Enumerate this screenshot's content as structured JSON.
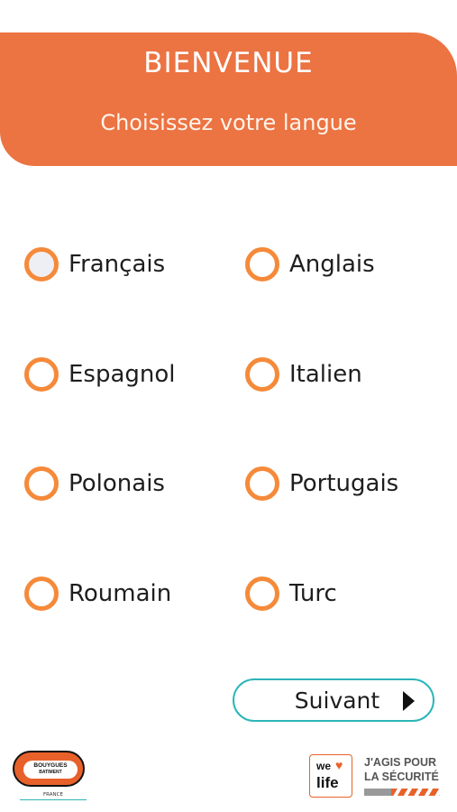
{
  "header": {
    "title": "BIENVENUE",
    "subtitle": "Choisissez votre langue"
  },
  "languages": [
    {
      "label": "Français",
      "selected": true
    },
    {
      "label": "Anglais",
      "selected": false
    },
    {
      "label": "Espagnol",
      "selected": false
    },
    {
      "label": "Italien",
      "selected": false
    },
    {
      "label": "Polonais",
      "selected": false
    },
    {
      "label": "Portugais",
      "selected": false
    },
    {
      "label": "Roumain",
      "selected": false
    },
    {
      "label": "Turc",
      "selected": false
    }
  ],
  "next_button": {
    "label": "Suivant",
    "icon": "play-arrow-icon"
  },
  "footer": {
    "bouygues_logo": {
      "line1": "BOUYGUES",
      "line2": "BATIMENT",
      "country": "FRANCE"
    },
    "welife_logo": {
      "we": "we",
      "life": "life",
      "icon": "heart-icon"
    },
    "safety_slogan": {
      "line1": "J'AGIS POUR",
      "line2": "LA SÉCURITÉ"
    }
  },
  "colors": {
    "header_bg": "#ec7342",
    "radio_ring": "#f58a3a",
    "button_border": "#2bb5b8",
    "brand_orange": "#e8612a"
  }
}
